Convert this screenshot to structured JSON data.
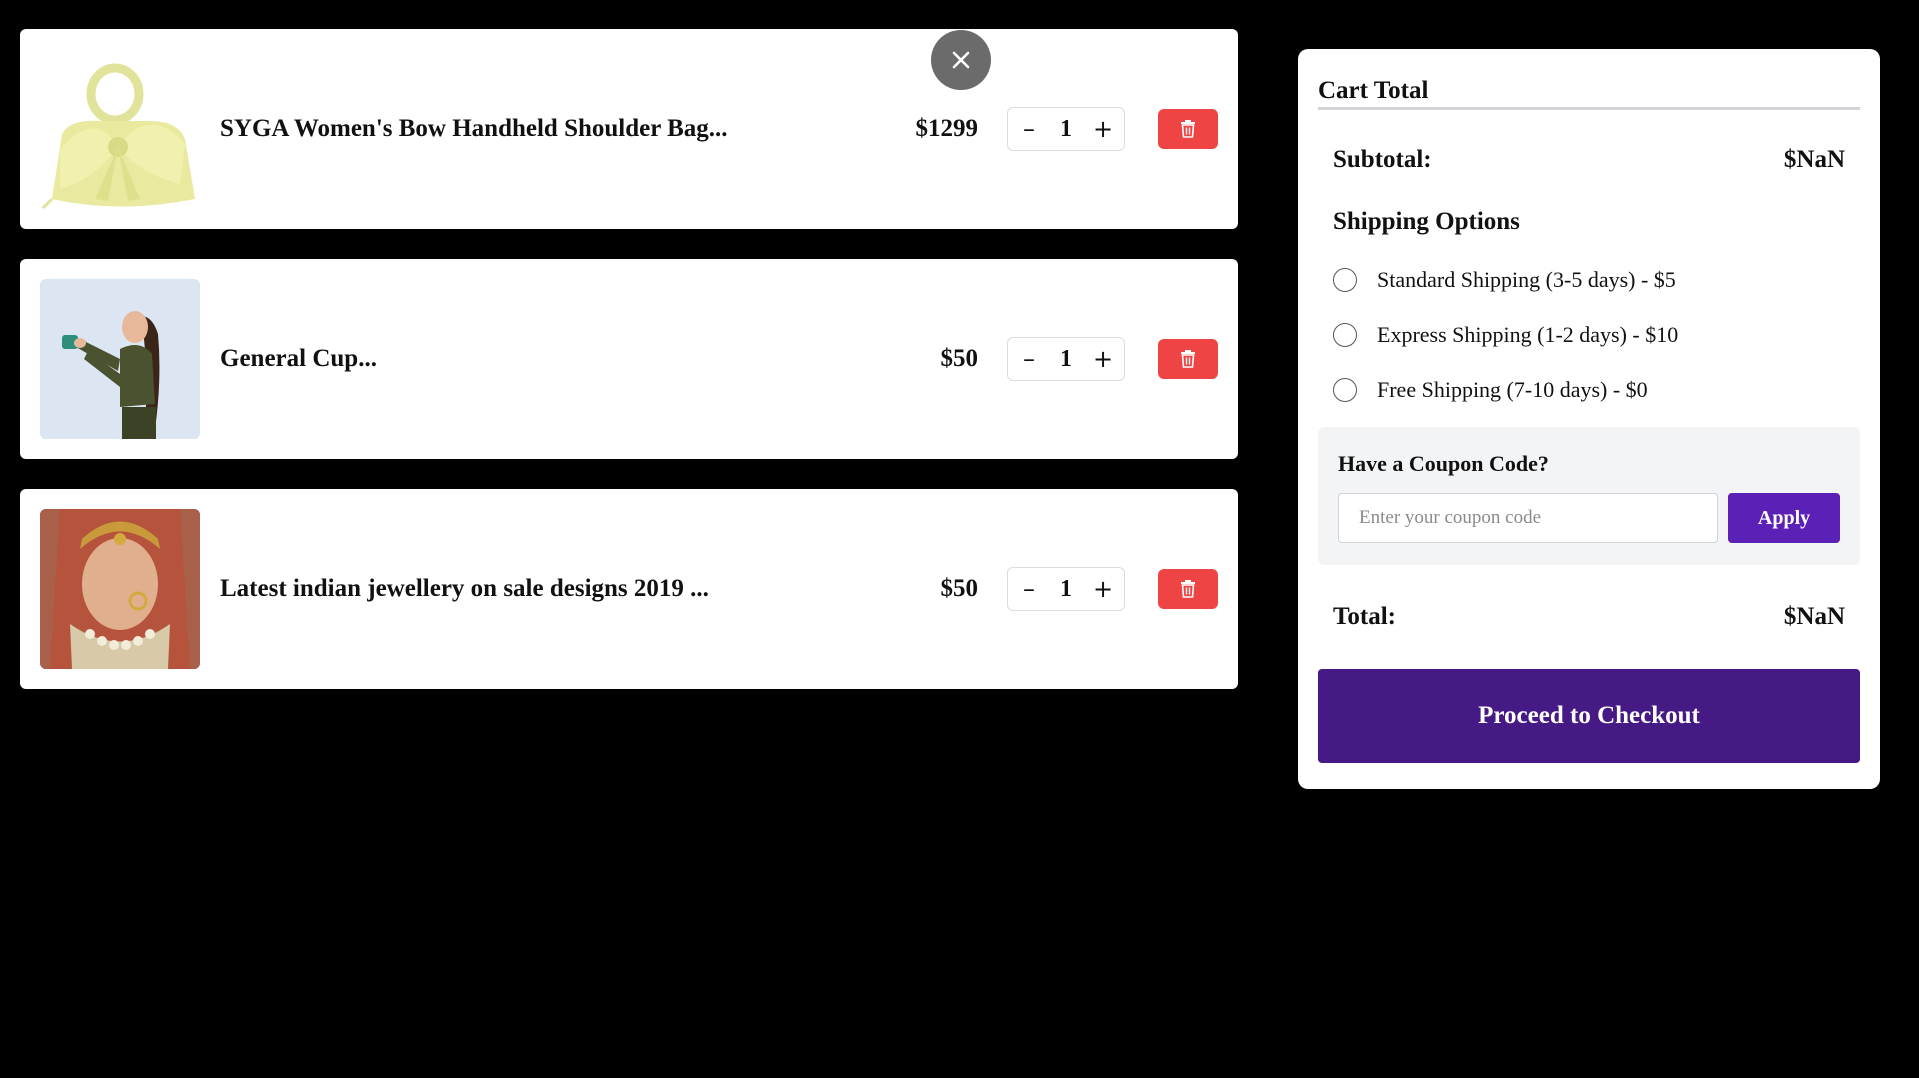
{
  "cart": {
    "items": [
      {
        "name": "SYGA Women's Bow Handheld Shoulder Bag...",
        "price": "$1299",
        "quantity": "1",
        "image": "yellow-bow-handbag"
      },
      {
        "name": "General Cup...",
        "price": "$50",
        "quantity": "1",
        "image": "woman-holding-cup"
      },
      {
        "name": "Latest indian jewellery on sale designs 2019 ...",
        "price": "$50",
        "quantity": "1",
        "image": "bridal-jewellery"
      }
    ],
    "decrement_symbol": "–",
    "increment_symbol": "+",
    "delete_icon": "trash-icon"
  },
  "close_button": {
    "icon": "close-icon"
  },
  "summary": {
    "title": "Cart Total",
    "subtotal_label": "Subtotal:",
    "subtotal_value": "$NaN",
    "shipping_heading": "Shipping Options",
    "shipping_options": [
      {
        "label": "Standard Shipping (3-5 days) - $5",
        "selected": false
      },
      {
        "label": "Express Shipping (1-2 days) - $10",
        "selected": false
      },
      {
        "label": "Free Shipping (7-10 days) - $0",
        "selected": false
      }
    ],
    "coupon": {
      "label": "Have a Coupon Code?",
      "placeholder": "Enter your coupon code",
      "value": "",
      "apply_label": "Apply"
    },
    "total_label": "Total:",
    "total_value": "$NaN",
    "checkout_label": "Proceed to Checkout"
  },
  "colors": {
    "delete_red": "#ef4444",
    "apply_purple": "#5b21b6",
    "checkout_purple": "#461a85",
    "close_gray": "#6b6b6b"
  }
}
